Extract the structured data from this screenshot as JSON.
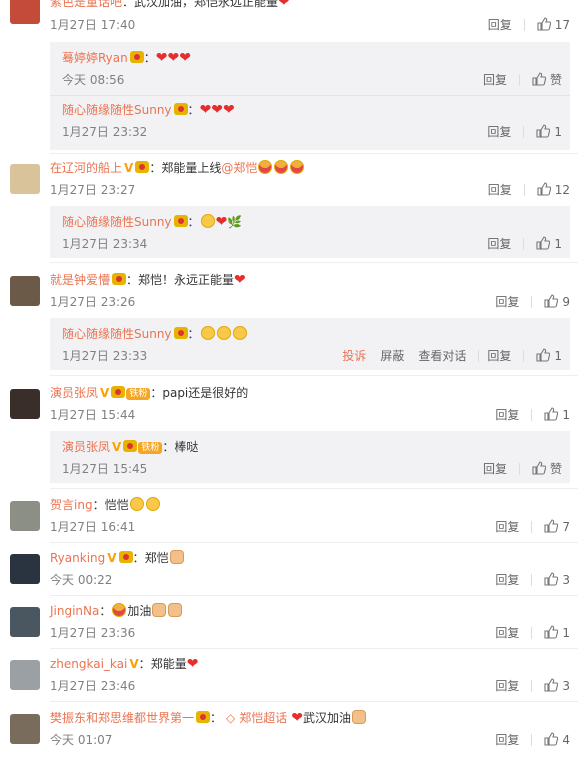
{
  "comments": [
    {
      "user": "紫色是童话吧",
      "sep": "：",
      "text": "武汉加油，郑恺永远正能量",
      "time": "1月27日 17:40",
      "reply_label": "回复",
      "likes": "17",
      "replies": [
        {
          "user": "蓦婷婷Ryan",
          "sep": "：",
          "text": "",
          "time": "今天 08:56",
          "reply_label": "回复",
          "likes": "赞"
        },
        {
          "user": "随心随缘随性Sunny",
          "sep": "：",
          "text": "",
          "time": "1月27日 23:32",
          "reply_label": "回复",
          "likes": "1"
        }
      ]
    },
    {
      "user": "在辽河的船上",
      "sep": "：",
      "text": "郑能量上线",
      "mention": "@郑恺",
      "time": "1月27日 23:27",
      "reply_label": "回复",
      "likes": "12",
      "replies": [
        {
          "user": "随心随缘随性Sunny",
          "sep": "：",
          "text": "",
          "time": "1月27日 23:34",
          "reply_label": "回复",
          "likes": "1"
        }
      ]
    },
    {
      "user": "就是钟爱懵",
      "sep": "：",
      "text": "郑恺！永远正能量",
      "time": "1月27日 23:26",
      "reply_label": "回复",
      "likes": "9",
      "replies": [
        {
          "user": "随心随缘随性Sunny",
          "sep": "：",
          "text": "",
          "time": "1月27日 23:33",
          "report_label": "投诉",
          "block_label": "屏蔽",
          "view_label": "查看对话",
          "reply_label": "回复",
          "likes": "1"
        }
      ]
    },
    {
      "user": "演员张凤",
      "fan_badge": "铁粉",
      "sep": "：",
      "text": "papi还是很好的",
      "time": "1月27日 15:44",
      "reply_label": "回复",
      "likes": "1",
      "replies": [
        {
          "user": "演员张凤",
          "fan_badge": "铁粉",
          "sep": "：",
          "text": "棒哒",
          "time": "1月27日 15:45",
          "reply_label": "回复",
          "likes": "赞"
        }
      ]
    },
    {
      "user": "贺言ing",
      "sep": "：",
      "text": "恺恺",
      "time": "1月27日 16:41",
      "reply_label": "回复",
      "likes": "7"
    },
    {
      "user": "Ryanking",
      "sep": "：",
      "text": "郑恺",
      "time": "今天 00:22",
      "reply_label": "回复",
      "likes": "3"
    },
    {
      "user": "JinginNa",
      "sep": "：",
      "text": "加油",
      "time": "1月27日 23:36",
      "reply_label": "回复",
      "likes": "1"
    },
    {
      "user": "zhengkai_kai",
      "sep": "：",
      "text": "郑能量",
      "time": "1月27日 23:46",
      "reply_label": "回复",
      "likes": "3"
    },
    {
      "user": "樊振东和郑思维都世界第一",
      "sep": "：",
      "topic": "郑恺超话",
      "text": "武汉加油",
      "time": "今天 01:07",
      "reply_label": "回复",
      "likes": "4"
    }
  ],
  "colors": {
    "username": "#eb7350",
    "meta": "#808080",
    "reply_bg": "#f2f2f5",
    "heart": "#e62e2e"
  }
}
